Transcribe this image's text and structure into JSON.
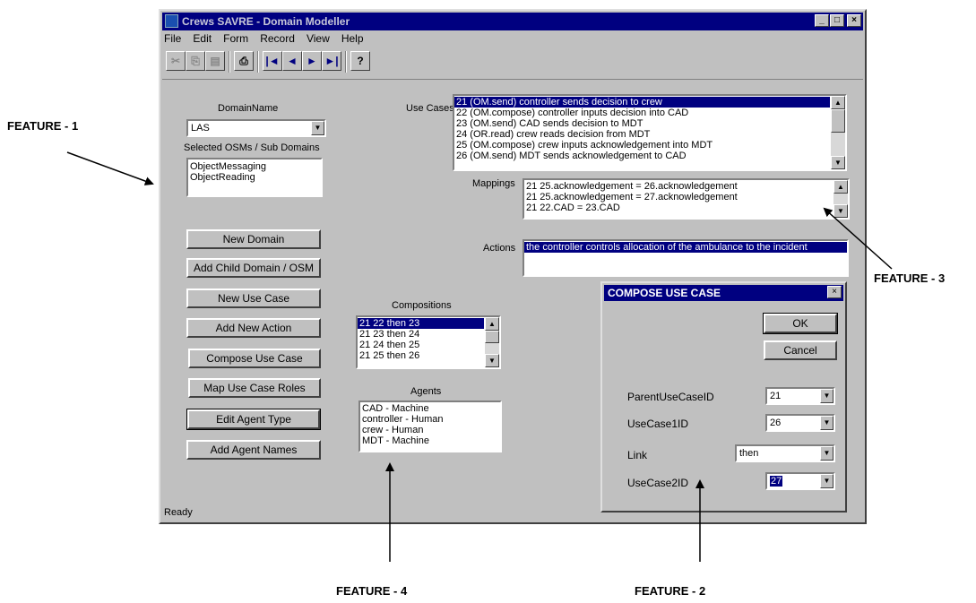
{
  "window": {
    "title": "Crews SAVRE - Domain Modeller",
    "caption_buttons": [
      "_",
      "□",
      "×"
    ]
  },
  "menu": [
    "File",
    "Edit",
    "Form",
    "Record",
    "View",
    "Help"
  ],
  "toolbar": {
    "cut": "✂",
    "copy": "⎘",
    "paste": "▤",
    "print": "⎙",
    "first": "|◄",
    "prev": "◄",
    "next": "►",
    "last": "►|",
    "help": "?"
  },
  "domain": {
    "label": "DomainName",
    "value": "LAS",
    "osm_label": "Selected OSMs / Sub Domains",
    "osms": [
      "ObjectMessaging",
      "ObjectReading"
    ]
  },
  "buttons": [
    "New Domain",
    "Add Child Domain / OSM",
    "New Use Case",
    "Add New Action",
    "Compose Use Case",
    "Map Use Case Roles",
    "Edit Agent Type",
    "Add Agent Names"
  ],
  "use_cases": {
    "label": "Use Cases",
    "items": [
      "21 (OM.send) controller sends decision to crew",
      "22 (OM.compose) controller inputs decision into CAD",
      "23 (OM.send) CAD sends decision to MDT",
      "24 (OR.read) crew reads decision from MDT",
      "25 (OM.compose) crew inputs acknowledgement into MDT",
      "26 (OM.send) MDT sends acknowledgement to CAD"
    ]
  },
  "mappings": {
    "label": "Mappings",
    "items": [
      "21   25.acknowledgement = 26.acknowledgement",
      "21   25.acknowledgement = 27.acknowledgement",
      "21   22.CAD = 23.CAD"
    ]
  },
  "actions": {
    "label": "Actions",
    "items": [
      "the controller controls allocation of the ambulance to the incident"
    ]
  },
  "compositions": {
    "label": "Compositions",
    "items": [
      "21   22 then 23",
      "21   23 then 24",
      "21   24 then 25",
      "21   25 then 26"
    ]
  },
  "agents": {
    "label": "Agents",
    "items": [
      "CAD - Machine",
      "controller - Human",
      "crew - Human",
      "MDT - Machine"
    ]
  },
  "status": "Ready",
  "dialog": {
    "title": "COMPOSE USE CASE",
    "ok": "OK",
    "cancel": "Cancel",
    "parent_label": "ParentUseCaseID",
    "parent_value": "21",
    "uc1_label": "UseCase1ID",
    "uc1_value": "26",
    "link_label": "Link",
    "link_value": "then",
    "uc2_label": "UseCase2ID",
    "uc2_value": "27"
  },
  "features": {
    "f1": "FEATURE - 1",
    "f2": "FEATURE - 2",
    "f3": "FEATURE - 3",
    "f4": "FEATURE - 4"
  }
}
